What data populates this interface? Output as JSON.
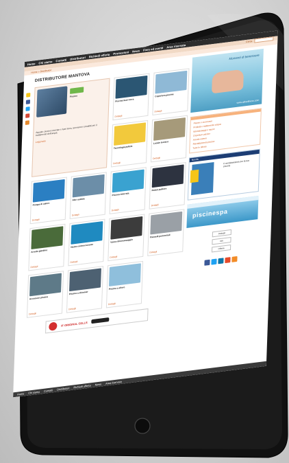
{
  "nav": {
    "items": [
      "Home",
      "Chi siamo",
      "Contatti",
      "Distributori",
      "Richiedi offerta",
      "Promozioni",
      "News",
      "Fiere ed eventi",
      "Area riservata"
    ]
  },
  "subbar": {
    "search_label": "Cerca"
  },
  "breadcrumb": "Home » Distributori",
  "page": {
    "title": "DISTRIBUTORE MANTOVA"
  },
  "feature": {
    "logo_text": "Piscine",
    "text": "Aquatic: piscine interrate e fuori terra, accessori e prodotti per il trattamento dell'acqua.",
    "link": "Leggi tutto"
  },
  "products": [
    {
      "name": "Piscina fuori terra",
      "link": "Dettagli",
      "color": "#2b5673"
    },
    {
      "name": "Copertura piscina",
      "link": "Dettagli",
      "color": "#8fb9d6"
    },
    {
      "name": "Tecnologia pulizia",
      "link": "Dettagli",
      "color": "#f2c93c"
    },
    {
      "name": "Locale tecnico",
      "link": "Dettagli",
      "color": "#a69a7a"
    },
    {
      "name": "Pompa di calore",
      "link": "Dettagli",
      "color": "#2b7fc2"
    },
    {
      "name": "Filtri sabbia",
      "link": "Dettagli",
      "color": "#6c8ea8"
    },
    {
      "name": "Piscina interrata",
      "link": "Dettagli",
      "color": "#3aa2d0"
    },
    {
      "name": "Robot pulitore",
      "link": "Dettagli",
      "color": "#2d3340"
    },
    {
      "name": "Arredo giardino",
      "link": "Dettagli",
      "color": "#4a6b3a"
    },
    {
      "name": "Nuoto controcorrente",
      "link": "Dettagli",
      "color": "#1f8ac0"
    },
    {
      "name": "Vasca idromassaggio",
      "link": "Dettagli",
      "color": "#3c3c3c"
    },
    {
      "name": "Pannelli perimetrali",
      "link": "Dettagli",
      "color": "#9aa0a6"
    },
    {
      "name": "Accessori piscina",
      "link": "Dettagli",
      "color": "#5e7a88"
    },
    {
      "name": "Piscina a skimmer",
      "link": "Dettagli",
      "color": "#4d6172"
    },
    {
      "name": "Piscina a sfioro",
      "link": "Dettagli",
      "color": "#8fbfdc"
    }
  ],
  "banner": {
    "text": "IF ORIGINAL CELLS"
  },
  "sidebar": {
    "ad1": {
      "brand": "Momenti di benessere",
      "url": "www.aliwellness.com"
    },
    "links": [
      "Piscine e accessori",
      "Prodotti e trattamento acqua",
      "Idromassaggi e saune",
      "Coperture piscine",
      "Arredo esterni",
      "Riscaldamento piscine",
      "Tutte le offerte"
    ],
    "ad2": {
      "header": "Novità",
      "text": "Il condizionatore per la tua piscina",
      "link": "Scopri"
    },
    "ad3": {
      "text": "piscinespa"
    },
    "badges": [
      "Dettagli",
      "Info",
      "Offerte"
    ]
  },
  "social_colors": [
    "#3b5998",
    "#1da1f2",
    "#0e76a8",
    "#e64b2a",
    "#f28c28"
  ],
  "footer": {
    "items": [
      "Home",
      "Chi siamo",
      "Contatti",
      "Distributori",
      "Richiedi offerta",
      "News",
      "Area riservata"
    ]
  }
}
